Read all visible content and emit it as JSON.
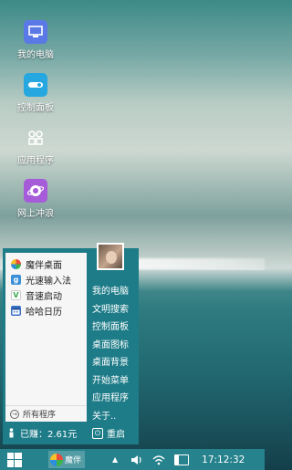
{
  "desktop": {
    "icons": [
      {
        "label": "我的电脑",
        "icon": "computer-icon"
      },
      {
        "label": "控制面板",
        "icon": "control-panel-icon"
      },
      {
        "label": "应用程序",
        "icon": "apps-grid-icon"
      },
      {
        "label": "网上冲浪",
        "icon": "globe-icon"
      }
    ]
  },
  "start_menu": {
    "programs": [
      {
        "label": "魔伴桌面",
        "icon": "pinwheel-icon"
      },
      {
        "label": "光速输入法",
        "icon": "input-method-icon"
      },
      {
        "label": "音速启动",
        "icon": "launcher-v-icon"
      },
      {
        "label": "哈哈日历",
        "icon": "calendar-icon"
      }
    ],
    "all_programs": "所有程序",
    "links": [
      "我的电脑",
      "文明搜索",
      "控制面板",
      "桌面图标",
      "桌面背景",
      "开始菜单",
      "应用程序",
      "关于.."
    ],
    "earned_label": "已赚：2.61元",
    "restart_label": "重启"
  },
  "taskbar": {
    "app_label": "魔伴",
    "tray_up": "▲",
    "battery_level": 0.25,
    "clock": "17:12:32"
  }
}
